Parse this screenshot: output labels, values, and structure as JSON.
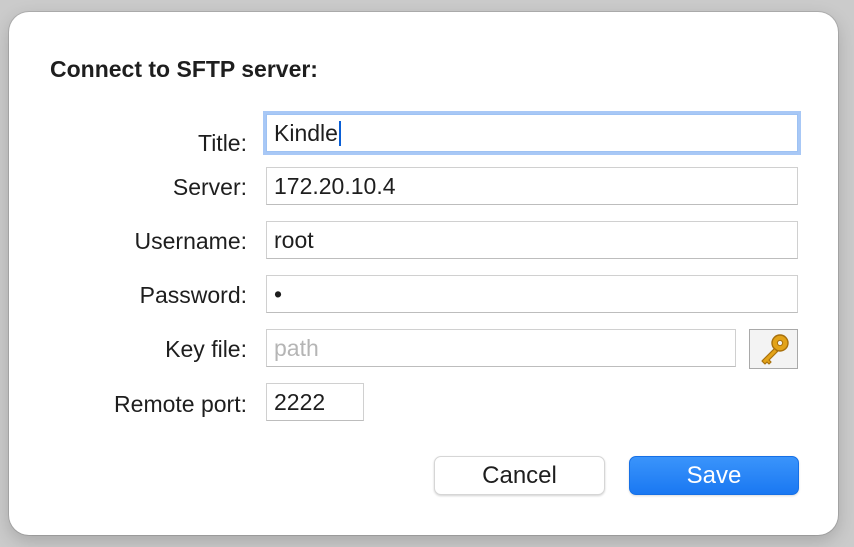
{
  "dialog": {
    "title": "Connect to SFTP server:",
    "fields": {
      "title": {
        "label": "Title:",
        "value": "Kindle"
      },
      "server": {
        "label": "Server:",
        "value": "172.20.10.4"
      },
      "username": {
        "label": "Username:",
        "value": "root"
      },
      "password": {
        "label": "Password:",
        "value": "•"
      },
      "key_file": {
        "label": "Key file:",
        "placeholder": "path",
        "button_icon": "key-icon"
      },
      "remote_port": {
        "label": "Remote port:",
        "value": "2222"
      }
    },
    "buttons": {
      "cancel": "Cancel",
      "save": "Save"
    }
  },
  "colors": {
    "accent": "#1a78f2",
    "focus_ring": "#a8c8f6",
    "key_gold": "#e3a319"
  }
}
